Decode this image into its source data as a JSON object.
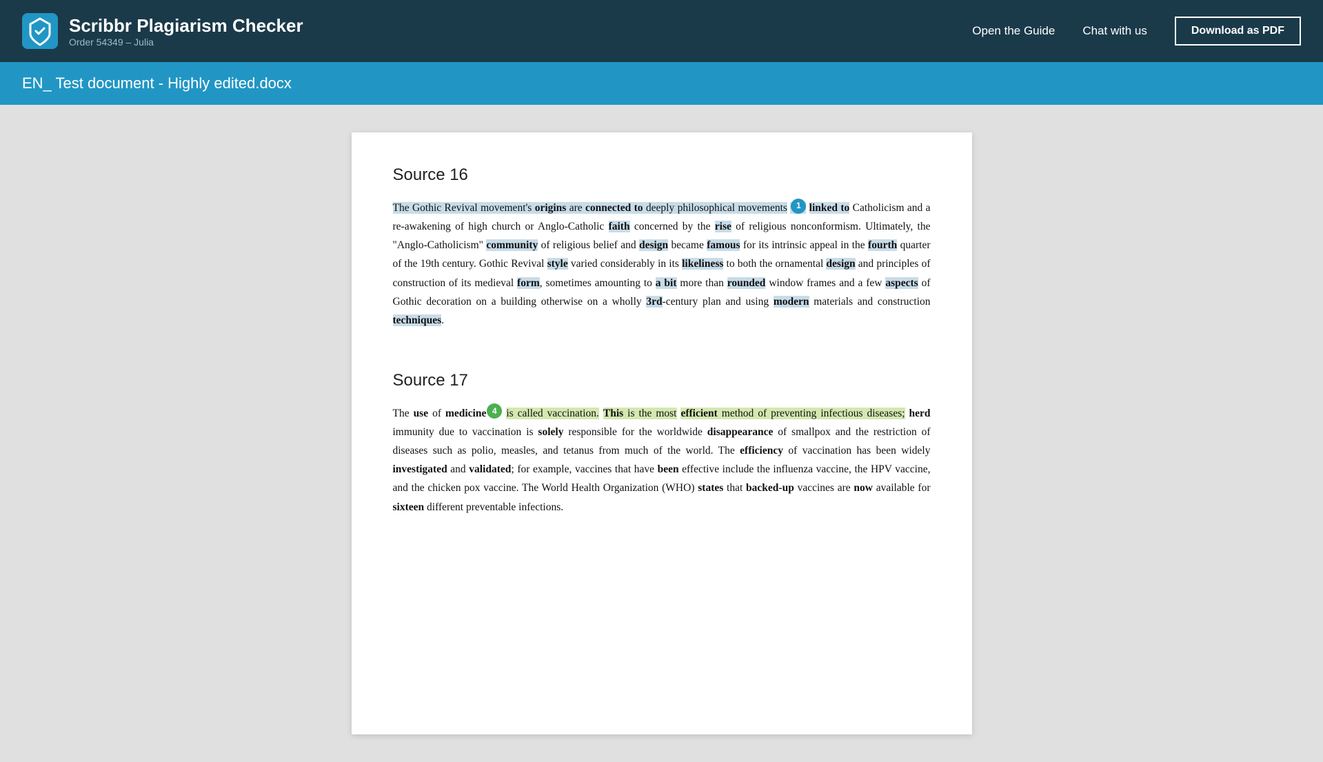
{
  "header": {
    "logo_alt": "Scribbr logo",
    "title": "Scribbr Plagiarism Checker",
    "order": "Order 54349 – Julia",
    "nav": {
      "guide": "Open the Guide",
      "chat": "Chat with us",
      "download": "Download as PDF"
    }
  },
  "file_bar": {
    "filename": "EN_ Test document - Highly edited.docx"
  },
  "source16": {
    "heading": "Source 16",
    "badge_number": "1",
    "badge_color": "blue",
    "paragraph": "The Gothic Revival movement's origins are connected to deeply philosophical movements linked to Catholicism and a re-awakening of high church or Anglo-Catholic faith concerned by the rise of religious nonconformism. Ultimately, the \"Anglo-Catholicism\" community of religious belief and design became famous for its intrinsic appeal in the fourth quarter of the 19th century. Gothic Revival style varied considerably in its likeliness to both the ornamental design and principles of construction of its medieval form, sometimes amounting to a bit more than rounded window frames and a few aspects of Gothic decoration on a building otherwise on a wholly 3rd-century plan and using modern materials and construction techniques."
  },
  "source17": {
    "heading": "Source 17",
    "badge_number": "4",
    "badge_color": "green",
    "paragraph": "The use of medicine is called vaccination. This is the most efficient method of preventing infectious diseases; herd immunity due to vaccination is solely responsible for the worldwide disappearance of smallpox and the restriction of diseases such as polio, measles, and tetanus from much of the world. The efficiency of vaccination has been widely investigated and validated; for example, vaccines that have been effective include the influenza vaccine, the HPV vaccine, and the chicken pox vaccine. The World Health Organization (WHO) states that backed-up vaccines are now available for sixteen different preventable infections."
  }
}
